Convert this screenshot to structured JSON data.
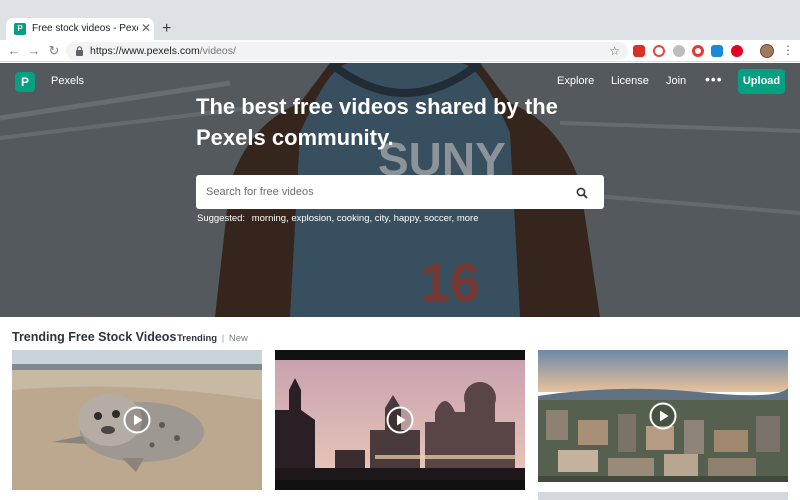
{
  "browser": {
    "tab_title": "Free stock videos - Pexels Videos",
    "new_tab_symbol": "+",
    "close_symbol": "✕",
    "url_domain": "https://www.pexels.com",
    "url_path": "/videos/"
  },
  "header": {
    "logo_letter": "P",
    "brand": "Pexels",
    "nav": [
      "Explore",
      "License",
      "Join"
    ],
    "more": "•••",
    "upload": "Upload"
  },
  "hero": {
    "title": "The best free videos shared by the Pexels community.",
    "search_placeholder": "Search for free videos",
    "suggested_label": "Suggested:",
    "suggestions": [
      "morning,",
      "explosion,",
      "cooking,",
      "city,",
      "happy,",
      "soccer,",
      "more"
    ]
  },
  "trending": {
    "title": "Trending Free Stock Videos",
    "filter_active": "Trending",
    "filter_separator": "|",
    "filter_inactive": "New"
  },
  "videos": [
    {
      "name": "seal-on-beach"
    },
    {
      "name": "palace-at-dusk"
    },
    {
      "name": "aerial-city-view"
    }
  ],
  "colors": {
    "brand": "#05a081",
    "text_dark": "#2c343e"
  }
}
